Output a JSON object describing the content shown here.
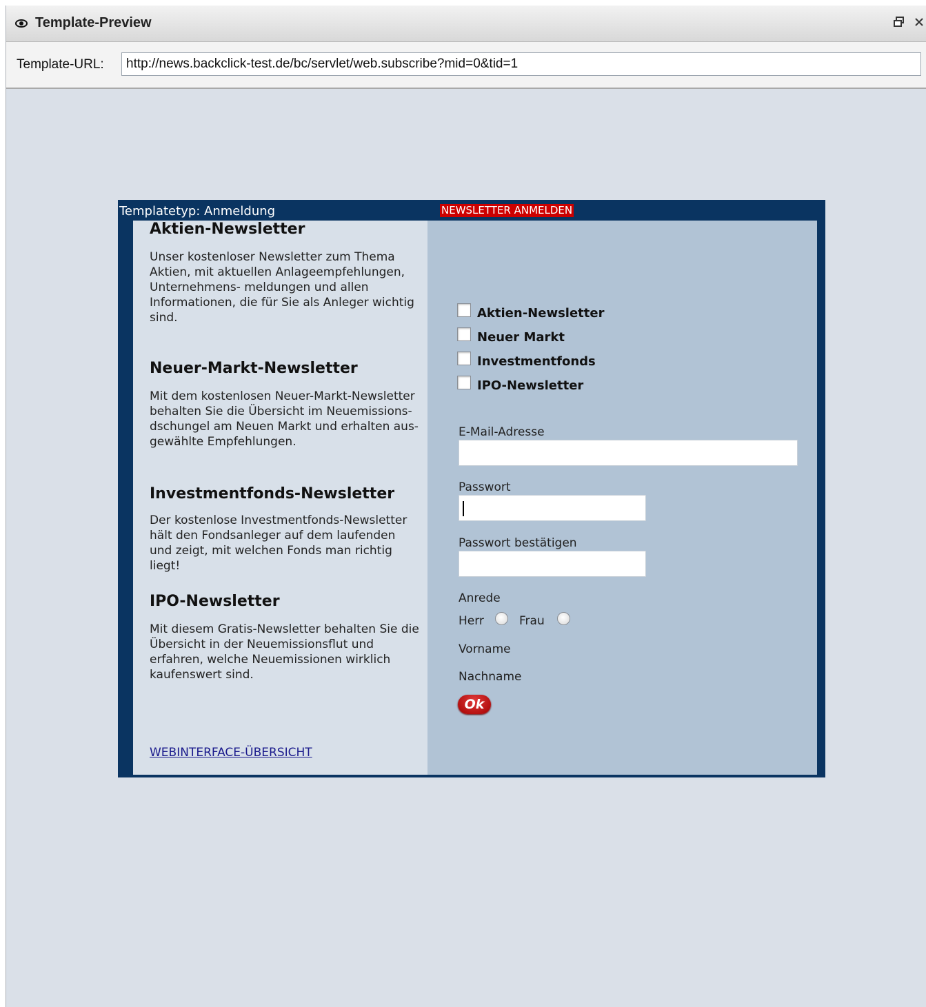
{
  "window": {
    "title": "Template-Preview",
    "icons": [
      "eye-icon",
      "restore-icon",
      "close-icon"
    ]
  },
  "urlbar": {
    "label": "Template-URL:",
    "value": "http://news.backclick-test.de/bc/servlet/web.subscribe?mid=0&tid=1"
  },
  "preview": {
    "header": "Templatetyp: Anmeldung",
    "badge": "NEWSLETTER ANMELDEN",
    "newsletters": [
      {
        "title": "Aktien-Newsletter",
        "desc": "Unser kostenloser Newsletter zum Thema Aktien, mit aktuellen Anlageempfehlungen, Unternehmens- meldungen und allen Informationen, die für Sie als Anleger wichtig sind."
      },
      {
        "title": "Neuer-Markt-Newsletter",
        "desc": "Mit dem kostenlosen Neuer-Markt-Newsletter behalten Sie die Übersicht im Neuemissions- dschungel am Neuen Markt und erhalten aus-gewählte Empfehlungen."
      },
      {
        "title": "Investmentfonds-Newsletter",
        "desc": "Der kostenlose Investmentfonds-Newsletter hält den Fondsanleger auf dem laufenden und zeigt, mit welchen Fonds man richtig liegt!"
      },
      {
        "title": "IPO-Newsletter",
        "desc": "Mit diesem Gratis-Newsletter behalten Sie die Übersicht in der Neuemissionsflut und erfahren, welche Neuemissionen wirklich kaufenswert sind."
      }
    ],
    "link": "WEBINTERFACE-ÜBERSICHT",
    "checkboxes": [
      "Aktien-Newsletter",
      "Neuer Markt",
      "Investmentfonds",
      "IPO-Newsletter"
    ],
    "form": {
      "email_label": "E-Mail-Adresse",
      "password_label": "Passwort",
      "password_confirm_label": "Passwort bestätigen",
      "salutation_label": "Anrede",
      "herr": "Herr",
      "frau": "Frau",
      "firstname_label": "Vorname",
      "lastname_label": "Nachname",
      "ok": "Ok"
    },
    "colors": {
      "frame": "#0a3461",
      "badge": "#cc0000",
      "left": "#d8e0e9",
      "right": "#b1c3d5"
    }
  }
}
